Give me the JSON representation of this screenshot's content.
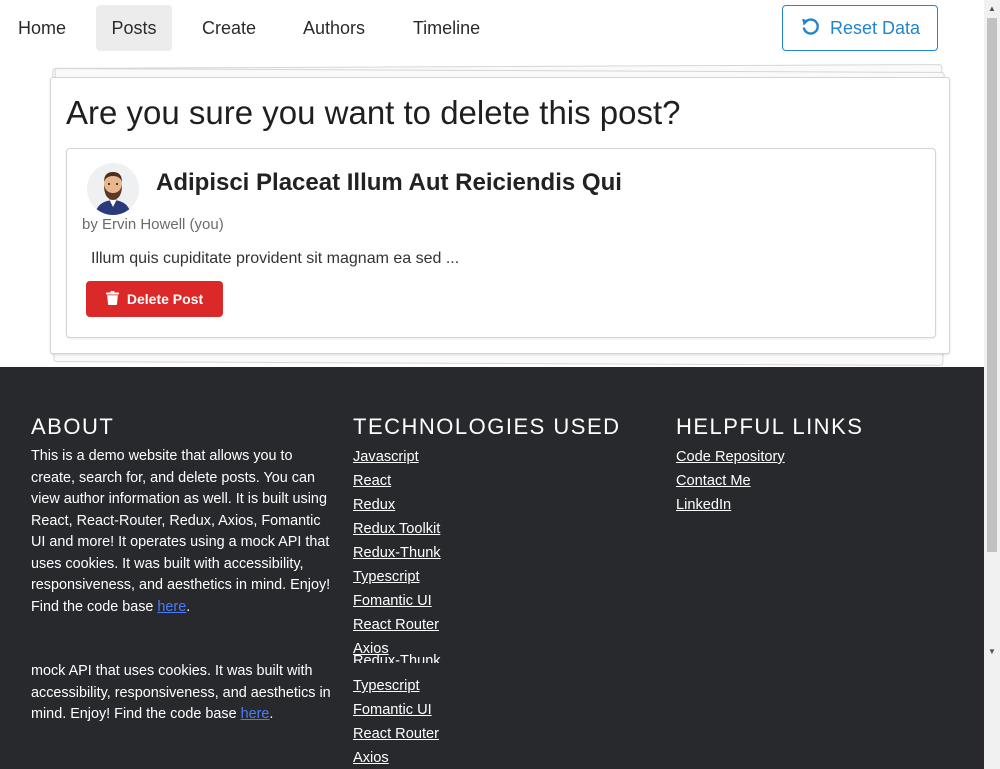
{
  "nav": {
    "items": [
      {
        "label": "Home",
        "active": false
      },
      {
        "label": "Posts",
        "active": true
      },
      {
        "label": "Create",
        "active": false
      },
      {
        "label": "Authors",
        "active": false
      },
      {
        "label": "Timeline",
        "active": false
      }
    ],
    "reset_label": "Reset Data",
    "reset_icon": "undo-icon"
  },
  "confirm": {
    "heading": "Are you sure you want to delete this post?"
  },
  "post": {
    "title": "Adipisci Placeat Illum Aut Reiciendis Qui",
    "author": "by Ervin Howell (you)",
    "excerpt": "Illum quis cupiditate provident sit magnam ea sed ...",
    "delete_label": "Delete Post",
    "delete_icon": "trash-icon",
    "avatar_icon": "bearded-man-avatar"
  },
  "footer": {
    "about": {
      "heading": "ABOUT",
      "text": "This is a demo website that allows you to create, search for, and delete posts. You can view author information as well. It is built using React, React-Router, Redux, Axios, Fomantic UI and more! It operates using a mock API that uses cookies. It was built with accessibility, responsiveness, and aesthetics in mind. Enjoy! Find the code base ",
      "link": "here",
      "period": ".",
      "repeat_text": "mock API that uses cookies. It was built with accessibility, responsiveness, and aesthetics in mind. Enjoy! Find the code base ",
      "repeat_link": "here",
      "repeat_period": "."
    },
    "technologies": {
      "heading": "TECHNOLOGIES USED",
      "items": [
        "Javascript",
        "React",
        "Redux",
        "Redux Toolkit",
        "Redux-Thunk",
        "Typescript",
        "Fomantic UI",
        "React Router",
        "Axios"
      ],
      "repeat_ghost": "Redux-Thunk",
      "repeat_items": [
        "Typescript",
        "Fomantic UI",
        "React Router",
        "Axios"
      ]
    },
    "links": {
      "heading": "HELPFUL LINKS",
      "items": [
        "Code Repository",
        "Contact Me",
        "LinkedIn"
      ]
    }
  },
  "colors": {
    "primary_blue": "#2185d0",
    "danger_red": "#db2828",
    "footer_bg": "#27292d",
    "link_blue": "#4b7bf5"
  }
}
